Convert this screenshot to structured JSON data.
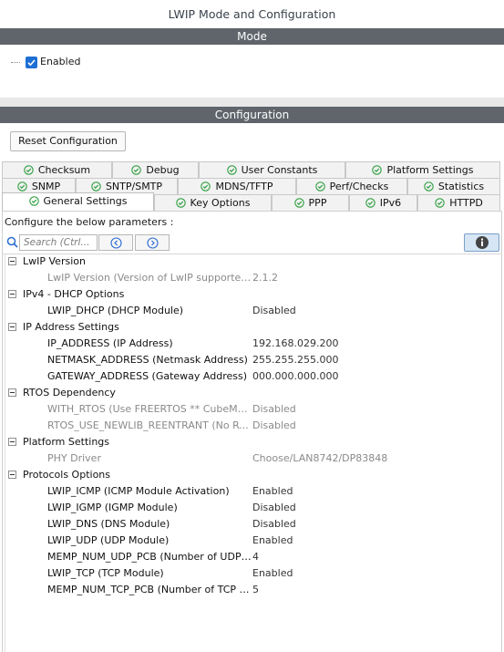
{
  "window": {
    "title": "LWIP Mode and Configuration"
  },
  "mode": {
    "header": "Mode",
    "enabled_label": "Enabled",
    "enabled_checked": true
  },
  "configuration": {
    "header": "Configuration",
    "reset_label": "Reset Configuration",
    "tab_rows": [
      [
        "Checksum",
        "Debug",
        "User Constants",
        "Platform Settings"
      ],
      [
        "SNMP",
        "SNTP/SMTP",
        "MDNS/TFTP",
        "Perf/Checks",
        "Statistics"
      ],
      [
        "General Settings",
        "Key Options",
        "PPP",
        "IPv6",
        "HTTPD"
      ]
    ],
    "active_tab": "General Settings",
    "configure_label": "Configure the below parameters :",
    "search_placeholder": "Search (Ctrl...",
    "groups": [
      {
        "label": "LwIP Version",
        "params": [
          {
            "name": "LwIP Version (Version of LwIP supported by…",
            "value": "2.1.2",
            "disabled": true
          }
        ]
      },
      {
        "label": "IPv4 - DHCP Options",
        "params": [
          {
            "name": "LWIP_DHCP (DHCP Module)",
            "value": "Disabled",
            "disabled": false
          }
        ]
      },
      {
        "label": "IP Address Settings",
        "params": [
          {
            "name": "IP_ADDRESS (IP Address)",
            "value": "192.168.029.200",
            "disabled": false
          },
          {
            "name": "NETMASK_ADDRESS (Netmask Address)",
            "value": "255.255.255.000",
            "disabled": false
          },
          {
            "name": "GATEWAY_ADDRESS (Gateway Address)",
            "value": "000.000.000.000",
            "disabled": false
          }
        ]
      },
      {
        "label": "RTOS Dependency",
        "params": [
          {
            "name": "WITH_RTOS (Use FREERTOS ** CubeMX s…",
            "value": "Disabled",
            "disabled": true
          },
          {
            "name": "RTOS_USE_NEWLIB_REENTRANT (No RTO…",
            "value": "Disabled",
            "disabled": true
          }
        ]
      },
      {
        "label": "Platform Settings",
        "params": [
          {
            "name": "PHY Driver",
            "value": "Choose/LAN8742/DP83848",
            "disabled": true
          }
        ]
      },
      {
        "label": "Protocols Options",
        "params": [
          {
            "name": "LWIP_ICMP (ICMP Module Activation)",
            "value": "Enabled",
            "disabled": false
          },
          {
            "name": "LWIP_IGMP (IGMP Module)",
            "value": "Disabled",
            "disabled": false
          },
          {
            "name": "LWIP_DNS (DNS Module)",
            "value": "Disabled",
            "disabled": false
          },
          {
            "name": "LWIP_UDP (UDP Module)",
            "value": "Enabled",
            "disabled": false
          },
          {
            "name": "MEMP_NUM_UDP_PCB (Number of UDP Con…",
            "value": "4",
            "disabled": false
          },
          {
            "name": "LWIP_TCP (TCP Module)",
            "value": "Enabled",
            "disabled": false
          },
          {
            "name": "MEMP_NUM_TCP_PCB (Number of TCP Con…",
            "value": "5",
            "disabled": false
          }
        ]
      }
    ]
  },
  "colors": {
    "section_bar": "#5f656b",
    "check_green": "#2e9e3f",
    "checkbox_blue": "#1e6fd4"
  },
  "icons": {
    "tab_status": "check-circle-icon",
    "search": "search-icon",
    "prev": "chevron-left-icon",
    "next": "chevron-right-icon",
    "info": "info-icon",
    "expand": "collapse-toggle-icon"
  }
}
